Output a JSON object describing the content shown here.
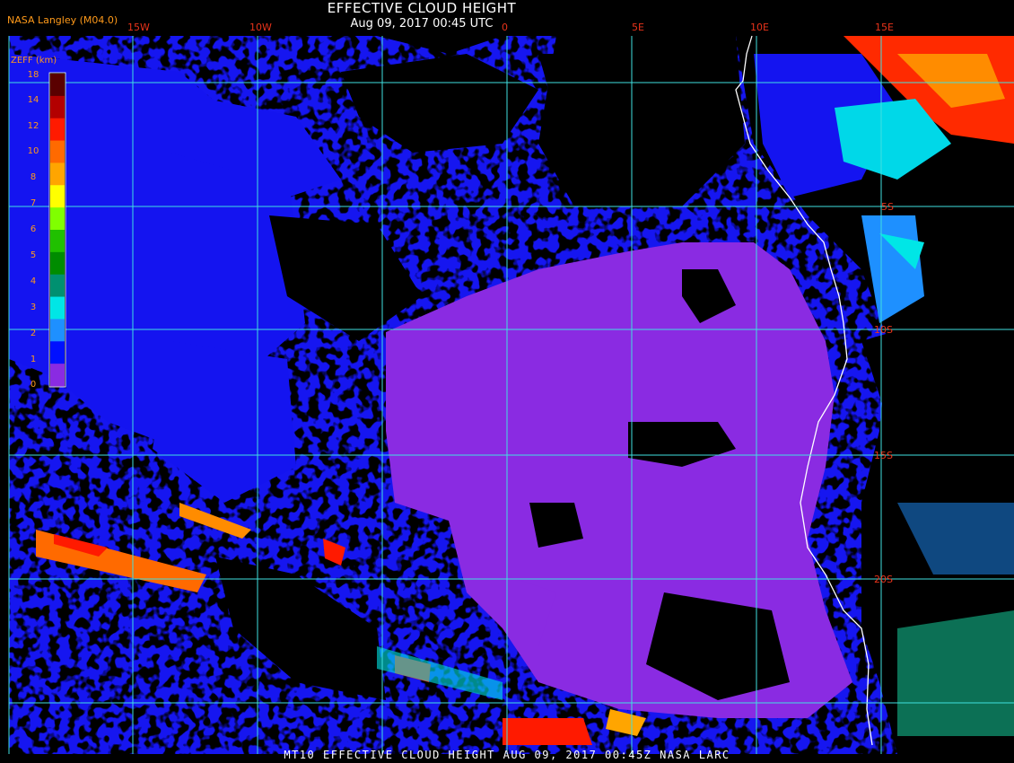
{
  "header": {
    "title": "EFFECTIVE CLOUD HEIGHT",
    "subtitle": "Aug 09, 2017 00:45 UTC",
    "credit": "NASA Langley (M04.0)"
  },
  "footer": {
    "text": "MT10  EFFECTIVE CLOUD HEIGHT   AUG 09, 2017 00:45Z   NASA LARC"
  },
  "colorbar": {
    "title": "ZEFF (km)",
    "ticks": [
      "18",
      "14",
      "12",
      "10",
      "8",
      "7",
      "6",
      "5",
      "4",
      "3",
      "2",
      "1",
      "0"
    ],
    "colors": [
      "#5a0000",
      "#b30000",
      "#ff1a00",
      "#ff6a00",
      "#ffa500",
      "#ffff00",
      "#80ff00",
      "#20c000",
      "#008c00",
      "#009070",
      "#00e6e6",
      "#1e90ff",
      "#0010ff",
      "#8a2be2"
    ]
  },
  "map": {
    "longitude_labels": [
      "15W",
      "10W",
      "0",
      "5E",
      "10E",
      "15E"
    ],
    "latitude_labels": [
      "5S",
      "10S",
      "15S",
      "20S"
    ],
    "colors": {
      "grid": "#40e0e0",
      "coast": "#ffffff",
      "clear": "#000000",
      "low_purple": "#8a2be2",
      "low_blue": "#1a1aff"
    }
  }
}
